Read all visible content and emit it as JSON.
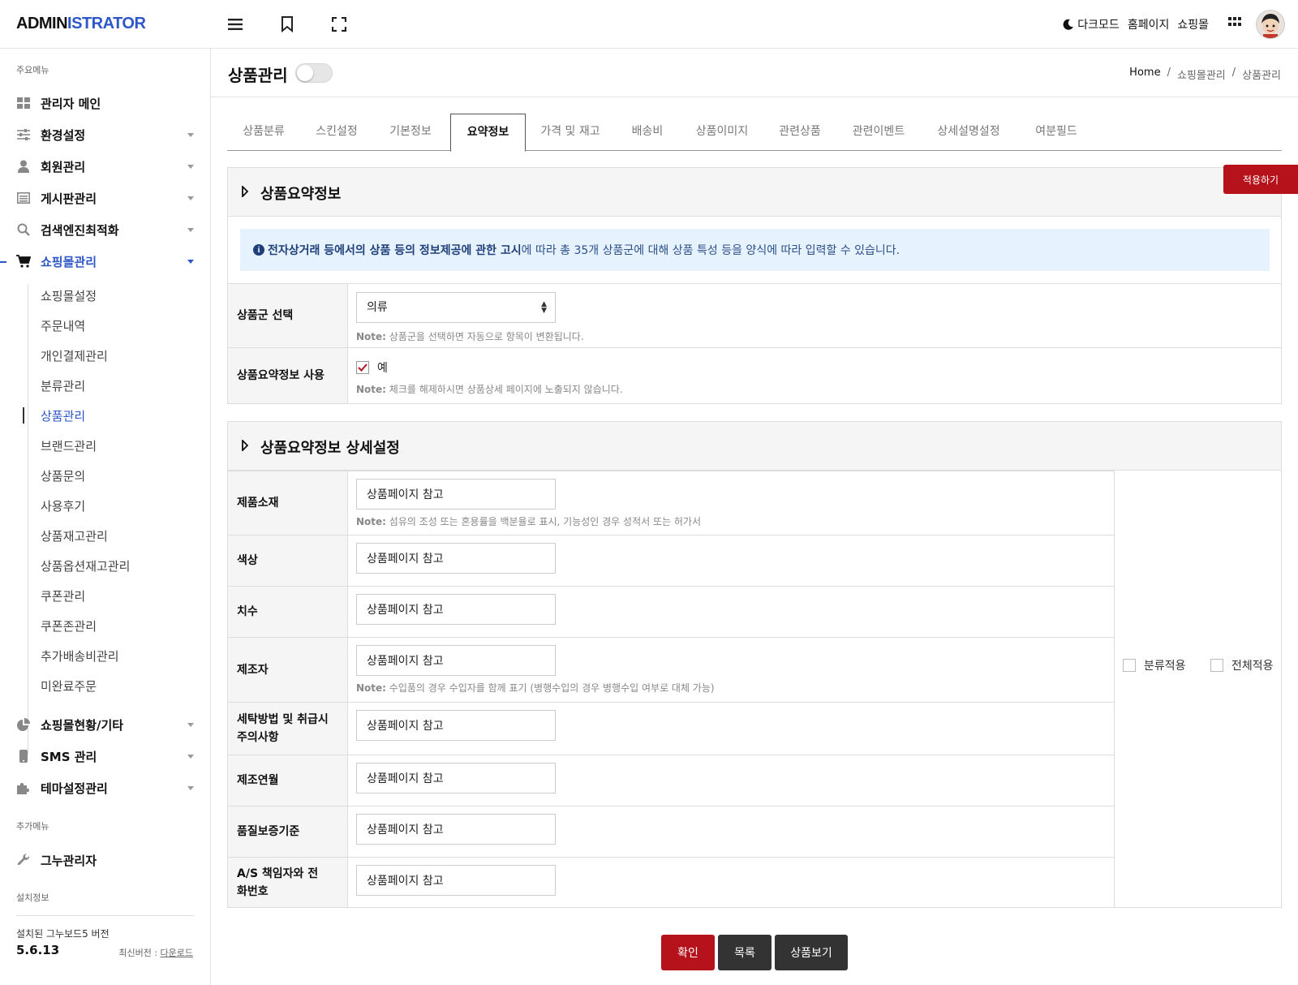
{
  "header": {
    "logo_a": "ADMIN",
    "logo_b": "ISTRATOR",
    "darkmode": "다크모드",
    "homepage": "홈페이지",
    "shop": "쇼핑몰",
    "icons": [
      "hamburger-icon",
      "bookmark-icon",
      "fullscreen-icon",
      "moon-icon",
      "apps-grid-icon"
    ]
  },
  "sidebar": {
    "main_title": "주요메뉴",
    "items": [
      {
        "label": "관리자 메인",
        "icon": "dashboard-icon"
      },
      {
        "label": "환경설정",
        "icon": "sliders-icon"
      },
      {
        "label": "회원관리",
        "icon": "user-icon"
      },
      {
        "label": "게시판관리",
        "icon": "list-icon"
      },
      {
        "label": "검색엔진최적화",
        "icon": "search-icon"
      },
      {
        "label": "쇼핑몰관리",
        "icon": "cart-icon"
      }
    ],
    "sub_items": [
      "쇼핑몰설정",
      "주문내역",
      "개인결제관리",
      "분류관리",
      "상품관리",
      "브랜드관리",
      "상품문의",
      "사용후기",
      "상품재고관리",
      "상품옵션재고관리",
      "쿠폰관리",
      "쿠폰존관리",
      "추가배송비관리",
      "미완료주문"
    ],
    "items2": [
      {
        "label": "쇼핑몰현황/기타",
        "icon": "pie-chart-icon"
      },
      {
        "label": "SMS 관리",
        "icon": "mobile-icon"
      },
      {
        "label": "테마설정관리",
        "icon": "puzzle-icon"
      }
    ],
    "extra_title": "추가메뉴",
    "extra_item": {
      "label": "그누관리자",
      "icon": "wrench-icon"
    },
    "install_title": "설치정보",
    "version_label": "설치된 그누보드5 버전",
    "version": "5.6.13",
    "latest_label": "최신버전 : ",
    "download": "다운로드"
  },
  "page": {
    "title": "상품관리",
    "breadcrumb": [
      "Home",
      "/",
      "쇼핑몰관리",
      "/",
      "상품관리"
    ]
  },
  "tabs": [
    "상품분류",
    "스킨설정",
    "기본정보",
    "요약정보",
    "가격 및 재고",
    "배송비",
    "상품이미지",
    "관련상품",
    "관련이벤트",
    "상세설명설정",
    "여분필드"
  ],
  "active_tab": "요약정보",
  "apply_button": "적용하기",
  "summary": {
    "title": "상품요약정보",
    "notice_strong": "전자상거래 등에서의 상품 등의 정보제공에 관한 고시",
    "notice_rest": "에 따라 총 35개 상품군에 대해 상품 특성 등을 양식에 따라 입력할 수 있습니다.",
    "group_label": "상품군 선택",
    "group_value": "의류",
    "group_note_b": "Note:",
    "group_note": " 상품군을 선택하면 자동으로 항목이 변환됩니다.",
    "use_label": "상품요약정보 사용",
    "use_value": "예",
    "use_note_b": "Note:",
    "use_note": " 체크를 해제하시면 상품상세 페이지에 노출되지 않습니다."
  },
  "detail": {
    "title": "상품요약정보 상세설정",
    "rows": [
      {
        "label": "제품소재",
        "value": "상품페이지 참고",
        "note": " 섬유의 조성 또는 혼용률을 백분율로 표시, 기능성인 경우 성적서 또는 허가서"
      },
      {
        "label": "색상",
        "value": "상품페이지 참고"
      },
      {
        "label": "치수",
        "value": "상품페이지 참고"
      },
      {
        "label": "제조자",
        "value": "상품페이지 참고",
        "note": " 수입품의 경우 수입자를 함께 표기 (병행수입의 경우 병행수입 여부로 대체 가능)"
      },
      {
        "label": "세탁방법 및 취급시 주의사항",
        "value": "상품페이지 참고"
      },
      {
        "label": "제조연월",
        "value": "상품페이지 참고"
      },
      {
        "label": "품질보증기준",
        "value": "상품페이지 참고"
      },
      {
        "label": "A/S 책임자와 전화번호",
        "value": "상품페이지 참고"
      }
    ],
    "note_b": "Note:",
    "apply_category": "분류적용",
    "apply_all": "전체적용"
  },
  "buttons": {
    "confirm": "확인",
    "list": "목록",
    "view": "상품보기"
  },
  "colors": {
    "accent": "#2d56c8",
    "danger": "#b5121b",
    "dark": "#333333",
    "notice_bg": "#e6f2fd"
  }
}
